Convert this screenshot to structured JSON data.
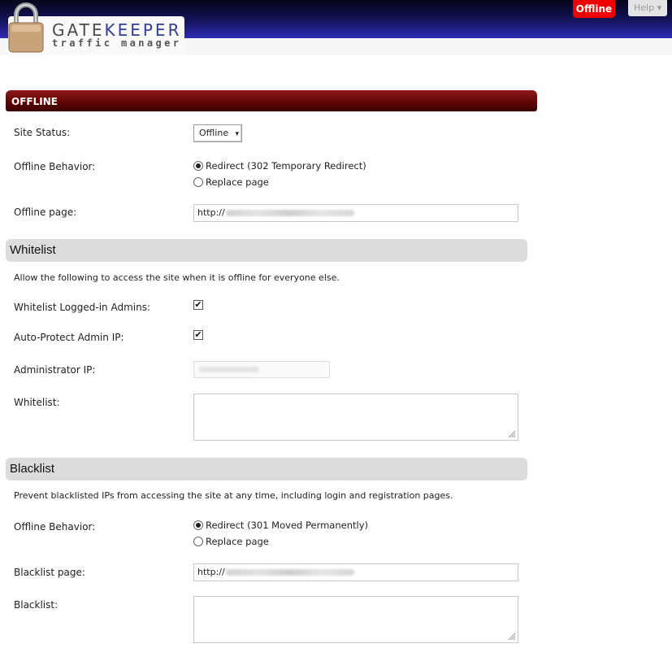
{
  "header": {
    "logo_gate": "GATE",
    "logo_keeper": "KEEPER",
    "logo_sub": "traffic manager",
    "status_badge": "Offline",
    "help": "Help ▾"
  },
  "offline": {
    "title": "OFFLINE",
    "site_status_label": "Site Status:",
    "site_status_value": "Offline",
    "behavior_label": "Offline Behavior:",
    "behavior_options": [
      "Redirect (302 Temporary Redirect)",
      "Replace page"
    ],
    "page_label": "Offline page:",
    "page_value": "http://"
  },
  "whitelist": {
    "title": "Whitelist",
    "description": "Allow the following to access the site when it is offline for everyone else.",
    "admins_label": "Whitelist Logged-in Admins:",
    "admins_checked": true,
    "autoprotect_label": "Auto-Protect Admin IP:",
    "autoprotect_checked": true,
    "admin_ip_label": "Administrator IP:",
    "list_label": "Whitelist:"
  },
  "blacklist": {
    "title": "Blacklist",
    "description": "Prevent blacklisted IPs from accessing the site at any time, including login and registration pages.",
    "behavior_label": "Offline Behavior:",
    "behavior_options": [
      "Redirect (301 Moved Permanently)",
      "Replace page"
    ],
    "page_label": "Blacklist page:",
    "page_value": "http://",
    "list_label": "Blacklist:"
  },
  "colors": {
    "header_dark": "#04041a",
    "header_light": "#2d2db6",
    "offline_red": "#ee0000",
    "section_maroon": "#5e0505",
    "section_grey": "#dcdcdc"
  }
}
